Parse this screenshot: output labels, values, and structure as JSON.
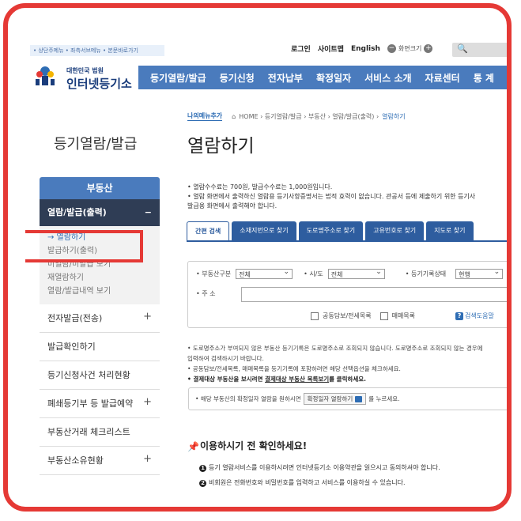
{
  "utility": {
    "skip_links": "• 상단주메뉴 • 좌측서브메뉴 • 본문바로가기",
    "login": "로그인",
    "sitemap": "사이트맵",
    "english": "English",
    "zoom_label": "화면크기",
    "zoom_minus": "−",
    "zoom_plus": "+",
    "search_icon_glyph": "🔍"
  },
  "logo": {
    "org": "대한민국 법원",
    "name": "인터넷등기소"
  },
  "gnb": [
    "등기열람/발급",
    "등기신청",
    "전자납부",
    "확정일자",
    "서비스 소개",
    "자료센터",
    "통 계"
  ],
  "breadcrumb": {
    "my_menu": "나의메뉴추가",
    "path": "HOME › 등기열람/발급 › 부동산 › 열람/발급(출력) ›",
    "current": "열람하기"
  },
  "side_title": "등기열람/발급",
  "page_title": "열람하기",
  "sidebar": {
    "header": "부동산",
    "open_item": "열람/발급(출력)",
    "open_mark": "−",
    "sub_items": [
      {
        "label": "→ 열람하기",
        "active": true
      },
      {
        "label": "발급하기(출력)",
        "active": false
      },
      {
        "label": "미열람/미발급 보기",
        "active": false
      },
      {
        "label": "재열람하기",
        "active": false
      },
      {
        "label": "열람/발급내역 보기",
        "active": false
      }
    ],
    "items": [
      {
        "label": "전자발급(전송)",
        "plus": "+"
      },
      {
        "label": "발급확인하기",
        "plus": ""
      },
      {
        "label": "등기신청사건 처리현황",
        "plus": ""
      },
      {
        "label": "폐쇄등기부 등 발급예약",
        "plus": "+"
      },
      {
        "label": "부동산거래 체크리스트",
        "plus": ""
      },
      {
        "label": "부동산소유현황",
        "plus": "+"
      }
    ]
  },
  "notices": [
    "• 열람수수료는 700원, 발급수수료는 1,000원입니다.",
    "• 열람 화면에서 출력하신 열람용 등기사항증명서는 법적 효력이 없습니다. 관공서 등에 제출하기 위한 등기사",
    "  발급용 화면에서 출력해야 합니다."
  ],
  "tabs": [
    "간편 검색",
    "소재지번으로 찾기",
    "도로명주소로 찾기",
    "고유번호로 찾기",
    "지도로 찾기"
  ],
  "form": {
    "type_label": "• 부동산구분",
    "type_value": "전체",
    "region_label": "• 시/도",
    "region_value": "전체",
    "status_label": "• 등기기록상태",
    "status_value": "현행",
    "address_label": "• 주 소",
    "opt1": "공동담보/전세목록",
    "opt2": "매매목록",
    "help": "검색도움말",
    "help_mark": "?"
  },
  "info": {
    "line1": "• 도로명주소가 부여되지 않은 부동산 등기기록은 도로명주소로 조회되지 않습니다. 도로명주소로 조회되지 않는 경우에",
    "line2": "  입력하여 검색하시기 바랍니다.",
    "line3": "• 공동담보/전세목록, 매매목록을 등기기록에 포함하려면 해당 선택옵션을 체크하세요.",
    "line4_pre": "• 결제대상 부동산을 보시려면 ",
    "line4_link": "결제대상 부동산 목록보기",
    "line4_post": "를 클릭하세요."
  },
  "confirm": {
    "pre": "• 해당 부동산의 확정일자 열람을 원하시면",
    "button": "확정일자 열람하기",
    "post": "를 누르세요."
  },
  "check": {
    "title": "이용하시기 전 확인하세요!",
    "items": [
      {
        "num": "1",
        "text": "등기 열람서비스를 이용하시려면 인터넷등기소 이용약관을 읽으시고 동의하셔야 합니다."
      },
      {
        "num": "2",
        "text": "비회원은 전화번호와 비밀번호를 입력하고 서비스를 이용하실 수 있습니다."
      }
    ]
  },
  "colors": {
    "highlight": "#e53935",
    "nav": "#4a7bbd",
    "sidebar_dark": "#2f3d55",
    "link": "#2e6db4"
  }
}
